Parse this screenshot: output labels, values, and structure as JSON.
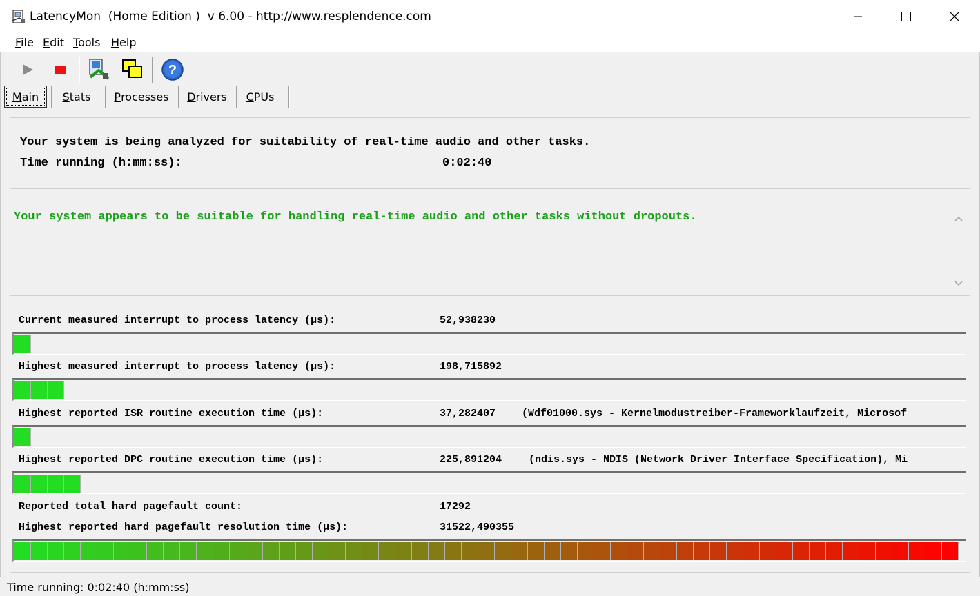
{
  "window": {
    "title": "LatencyMon  (Home Edition )  v 6.00 - http://www.resplendence.com",
    "icon": "latencymon-app-icon",
    "controls": [
      "minimize-icon",
      "maximize-icon",
      "close-icon"
    ]
  },
  "menu": {
    "items": [
      {
        "label": "File",
        "accel": "F",
        "rest": "ile"
      },
      {
        "label": "Edit",
        "accel": "E",
        "rest": "dit"
      },
      {
        "label": "Tools",
        "accel": "T",
        "rest": "ools"
      },
      {
        "label": "Help",
        "accel": "H",
        "rest": "elp"
      }
    ]
  },
  "toolbar": {
    "buttons": [
      "play-icon",
      "stop-icon",
      "analyze-icon",
      "windows-icon",
      "help-icon"
    ]
  },
  "tabs": [
    {
      "label": "Main",
      "accel": "M",
      "rest": "ain",
      "active": true
    },
    {
      "label": "Stats",
      "accel": "S",
      "rest": "tats",
      "active": false
    },
    {
      "label": "Processes",
      "accel": "P",
      "rest": "rocesses",
      "active": false
    },
    {
      "label": "Drivers",
      "accel": "D",
      "rest": "rivers",
      "active": false
    },
    {
      "label": "CPUs",
      "accel": "C",
      "rest": "PUs",
      "active": false
    }
  ],
  "analysis": {
    "status_line": "Your system is being analyzed for suitability of real-time audio and other tasks.",
    "time_label": "Time running (h:mm:ss):",
    "time_value": "0:02:40"
  },
  "verdict": {
    "message": "Your system appears to be suitable for handling real-time audio and other tasks without dropouts.",
    "color": "#1aa11a"
  },
  "measurements": [
    {
      "label": "Current measured interrupt to process latency (µs):",
      "value": "52,938230",
      "detail": "",
      "meter_segments": 1
    },
    {
      "label": "Highest measured interrupt to process latency (µs):",
      "value": "198,715892",
      "detail": "",
      "meter_segments": 3
    },
    {
      "label": "Highest reported ISR routine execution time (µs):",
      "value": "37,282407",
      "detail": "(Wdf01000.sys - Kernelmodustreiber-Frameworklaufzeit, Microsof",
      "meter_segments": 1
    },
    {
      "label": "Highest reported DPC routine execution time (µs):",
      "value": "225,891204",
      "detail": "(ndis.sys - NDIS (Network Driver Interface Specification), Mi",
      "meter_segments": 4
    }
  ],
  "pagefaults": {
    "count_label": "Reported total hard pagefault count:",
    "count_value": "17292",
    "resolution_label": "Highest reported hard pagefault resolution time (µs):",
    "resolution_value": "31522,490355",
    "meter_segments": 57
  },
  "colors": {
    "meter_green": "#22dd22",
    "meter_red": "#ff0000"
  },
  "status_bar": {
    "text": "Time running: 0:02:40  (h:mm:ss)"
  }
}
